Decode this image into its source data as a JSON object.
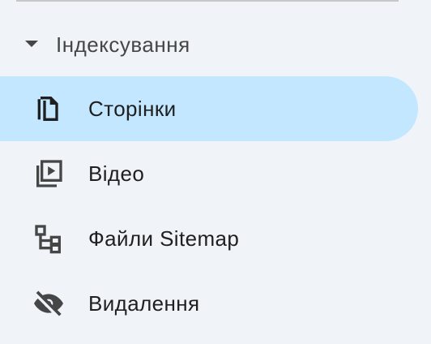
{
  "section": {
    "title": "Індексування",
    "expanded_icon": "caret-down-icon"
  },
  "nav": {
    "items": [
      {
        "label": "Сторінки",
        "icon": "pages-icon",
        "active": true
      },
      {
        "label": "Відео",
        "icon": "video-pages-icon",
        "active": false
      },
      {
        "label": "Файли Sitemap",
        "icon": "sitemap-icon",
        "active": false
      },
      {
        "label": "Видалення",
        "icon": "removals-icon",
        "active": false
      }
    ]
  },
  "colors": {
    "background": "#f0f4f9",
    "active_background": "#c2e7ff",
    "text": "#1f1f1f",
    "secondary_text": "#444746",
    "divider": "#c7c7c7"
  }
}
